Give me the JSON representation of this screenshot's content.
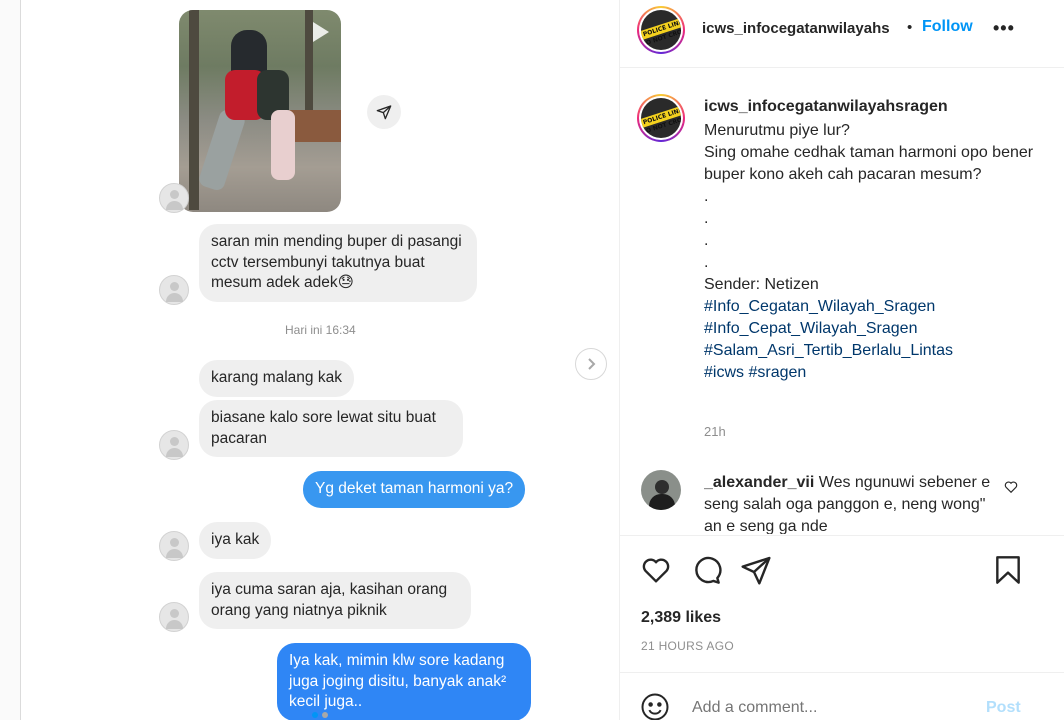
{
  "header": {
    "username": "icws_infocegatanwilayahs",
    "bullet": "•",
    "follow_label": "Follow",
    "more_label": "•••",
    "avatar_text": "POLICE LINE DO NOT CROSS"
  },
  "chat": {
    "messages": [
      {
        "text": "saran min mending buper di pasangi cctv tersembunyi takutnya buat mesum adek adek😓"
      },
      {
        "text": "karang malang kak"
      },
      {
        "text": "biasane kalo sore lewat situ buat pacaran"
      },
      {
        "text": "Yg deket taman harmoni ya?"
      },
      {
        "text": "iya kak"
      },
      {
        "text": "iya cuma saran aja, kasihan orang orang yang niatnya piknik"
      },
      {
        "text": "Iya kak, mimin klw sore kadang juga joging disitu, banyak anak² kecil juga.."
      }
    ],
    "timestamp": "Hari ini 16:34"
  },
  "caption": {
    "username": "icws_infocegatanwilayahsragen",
    "lines": [
      "Menurutmu piye lur?",
      "Sing omahe cedhak taman harmoni opo bener buper kono akeh cah pacaran mesum?",
      ".",
      ".",
      ".",
      ".",
      "Sender: Netizen"
    ],
    "hashtags": [
      "#Info_Cegatan_Wilayah_Sragen",
      "#Info_Cepat_Wilayah_Sragen",
      "#Salam_Asri_Tertib_Berlalu_Lintas",
      "#icws",
      "#sragen"
    ],
    "time": "21h"
  },
  "comment": {
    "username": "_alexander_vii",
    "text": "Wes ngunuwi sebener e seng salah oga panggon e, neng wong\" an e seng ga nde"
  },
  "stats": {
    "likes": "2,389 likes",
    "ago": "21 HOURS AGO"
  },
  "add_comment": {
    "placeholder": "Add a comment...",
    "post_label": "Post"
  },
  "colors": {
    "accent": "#0095f6",
    "bubble_out": "#3897f0",
    "bubble_in": "#efefef"
  }
}
